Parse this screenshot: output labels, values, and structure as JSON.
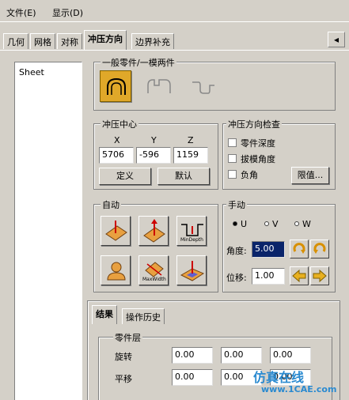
{
  "menu": {
    "file": "文件(E)",
    "view": "显示(D)"
  },
  "tabs": [
    "几何",
    "网格",
    "对称",
    "冲压方向",
    "边界补充"
  ],
  "tab_arrow": "◂",
  "sheet_list": {
    "item": "Sheet"
  },
  "part_group": {
    "legend": "一般零件/一模两件"
  },
  "stamp_center": {
    "legend": "冲压中心",
    "x_label": "X",
    "y_label": "Y",
    "z_label": "Z",
    "x_value": "5706",
    "y_value": "-596",
    "z_value": "1159",
    "define_button": "定义",
    "default_button": "默认"
  },
  "direction_check": {
    "legend": "冲压方向检查",
    "part_depth": "零件深度",
    "draft_angle": "拔模角度",
    "negative_angle": "负角",
    "limits_button": "限值..."
  },
  "auto": {
    "legend": "自动",
    "min_depth": "MinDepth",
    "max_width": "MaxWidth"
  },
  "manual": {
    "legend": "手动",
    "axis_u": "U",
    "axis_v": "V",
    "axis_w": "W",
    "angle_label": "角度:",
    "angle_value": "5.00",
    "shift_label": "位移:",
    "shift_value": "1.00"
  },
  "result_tabs": {
    "result": "结果",
    "history": "操作历史"
  },
  "part_layer": {
    "legend": "零件层",
    "rotate_label": "旋转",
    "translate_label": "平移",
    "rotate_values": [
      "0.00",
      "0.00",
      "0.00"
    ],
    "translate_values": [
      "0.00",
      "0.00",
      "0.00"
    ]
  },
  "watermark": {
    "title": "仿真在线",
    "url": "www.1CAE.com"
  },
  "colors": {
    "face": "#d4d0c8",
    "pressed": "#e0a829",
    "selection": "#0a246a",
    "watermark": "#2a8ad0"
  }
}
